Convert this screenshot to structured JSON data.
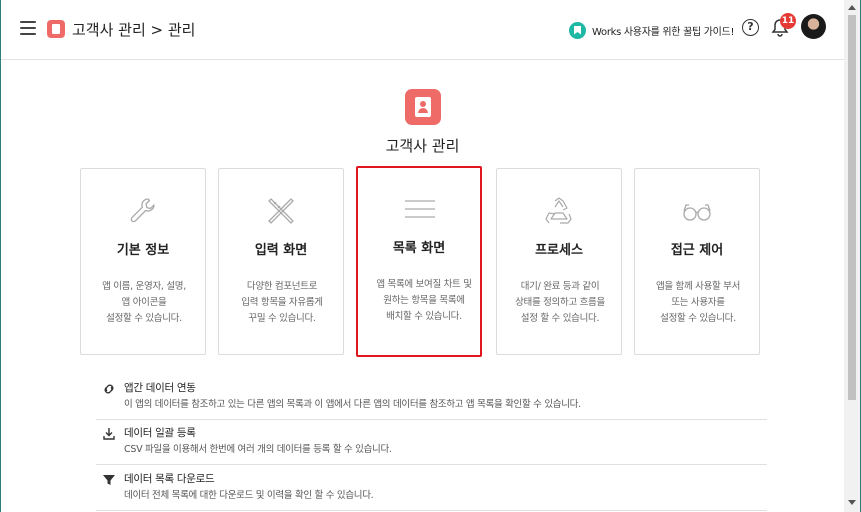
{
  "header": {
    "breadcrumb": "고객사 관리 > 관리",
    "guide_text": "Works 사용자를 위한 꿀팁 가이드!",
    "help_icon": "question-circle-icon",
    "notification_count": "11"
  },
  "main": {
    "app_title": "고객사 관리",
    "cards": [
      {
        "title": "기본 정보",
        "desc": "앱 이름, 운영자, 설명,\n앱 아이콘을\n설정할 수 있습니다.",
        "icon": "wrench-icon"
      },
      {
        "title": "입력 화면",
        "desc": "다양한 컴포넌트로\n입력 항목을 자유롭게\n꾸밀 수 있습니다.",
        "icon": "pencil-ruler-icon"
      },
      {
        "title": "목록 화면",
        "desc": "앱 목록에 보여질 차트 및\n원하는 항목을 목록에\n배치할 수 있습니다.",
        "icon": "list-lines-icon"
      },
      {
        "title": "프로세스",
        "desc": "대기/ 완료 등과 같이\n상태를 정의하고 흐름을\n설정 할 수 있습니다.",
        "icon": "recycle-icon"
      },
      {
        "title": "접근 제어",
        "desc": "앱을 함께 사용할 부서\n또는 사용자를\n설정할 수 있습니다.",
        "icon": "glasses-icon"
      }
    ],
    "list": [
      {
        "title": "앱간 데이터 연동",
        "desc": "이 앱의 데이터를 참조하고 있는 다른 앱의 목록과 이 앱에서 다른 앱의 데이터를 참조하고 앱 목록을 확인할 수 있습니다.",
        "icon": "link-icon"
      },
      {
        "title": "데이터 일괄 등록",
        "desc": "CSV 파일을 이용해서 한번에 여러 개의 데이터를 등록 할 수 있습니다.",
        "icon": "download-icon"
      },
      {
        "title": "데이터 목록 다운로드",
        "desc": "데이터 전체 목록에 대한 다운로드 및 이력을 확인 할 수 있습니다.",
        "icon": "filter-icon"
      }
    ]
  },
  "colors": {
    "accent": "#ef6b67",
    "selection_border": "#e0161e",
    "guide_icon": "#1fb8a4",
    "badge": "#e53935"
  }
}
